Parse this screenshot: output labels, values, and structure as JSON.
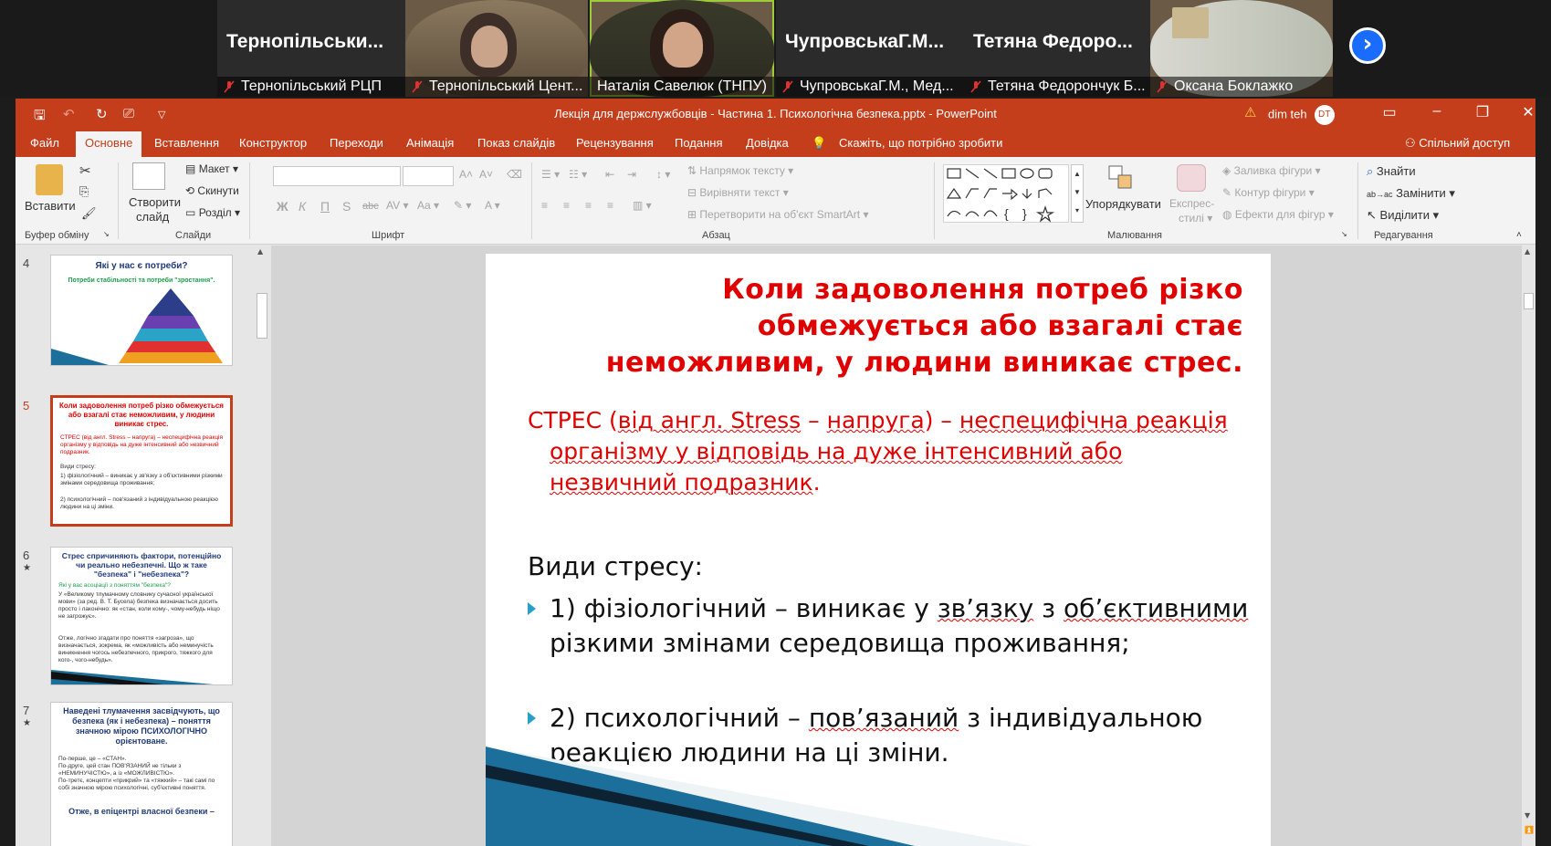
{
  "participants": [
    {
      "name_big": "Тернопільськи...",
      "caption": "Тернопільський РЦП",
      "video": false
    },
    {
      "name_big": "",
      "caption": "Тернопільський Цент...",
      "video": true
    },
    {
      "name_big": "",
      "caption": "Наталія Савелюк (ТНПУ)",
      "video": true
    },
    {
      "name_big": "ЧупровськаГ.М...",
      "caption": "ЧупровськаГ.М., Мед...",
      "video": false
    },
    {
      "name_big": "Тетяна Федоро...",
      "caption": "Тетяна Федорончук Б...",
      "video": false
    },
    {
      "name_big": "",
      "caption": "Оксана Боклажко",
      "video": true
    }
  ],
  "window": {
    "title": "Лекція для держслужбовців - Частина 1. Психологічна безпека.pptx  -  PowerPoint",
    "user_name": "dim teh",
    "user_initials": "DT"
  },
  "tabs": [
    "Файл",
    "Основне",
    "Вставлення",
    "Конструктор",
    "Переходи",
    "Анімація",
    "Показ слайдів",
    "Рецензування",
    "Подання",
    "Довідка"
  ],
  "tell_me": "Скажіть, що потрібно зробити",
  "share": "Спільний доступ",
  "ribbon": {
    "paste": "Вставити",
    "clipboard_group": "Буфер обміну",
    "new_slide_1": "Створити",
    "new_slide_2": "слайд",
    "layout": "Макет",
    "reset": "Скинути",
    "section": "Розділ",
    "slides_group": "Слайди",
    "font_group": "Шрифт",
    "text_direction": "Напрямок тексту",
    "align_text": "Вирівняти текст",
    "smartart": "Перетворити на об'єкт SmartArt",
    "paragraph_group": "Абзац",
    "arrange": "Упорядкувати",
    "quick_styles_1": "Експрес-",
    "quick_styles_2": "стилі",
    "shape_fill": "Заливка фігури",
    "shape_outline": "Контур фігури",
    "shape_effects": "Ефекти для фігур",
    "drawing_group": "Малювання",
    "find": "Знайти",
    "replace": "Замінити",
    "select": "Виділити",
    "editing_group": "Редагування"
  },
  "thumbnails": {
    "s4": {
      "num": "4",
      "title": "Які у нас є потреби?",
      "subtitle": "Потреби стабільності та потреби \"зростання\"."
    },
    "s5": {
      "num": "5",
      "title": "Коли задоволення потреб різко обмежується або взагалі стає неможливим, у людини виникає стрес.",
      "l1": "СТРЕС (від англ. Stress – напруга) – неспецифічна реакція організму у відповідь на дуже інтенсивний або незвичний подразник.",
      "l2": "Види стресу:",
      "l3": "1) фізіологічний – виникає у зв'язку з об'єктивними різкими змінами середовища проживання;",
      "l4": "2) психологічний – пов'язаний з індивідуальною реакцією людини на ці зміни."
    },
    "s6": {
      "num": "6",
      "title": "Стрес спричиняють фактори, потенційно чи реально небезпечні. Що ж таке \"безпека\" і \"небезпека\"?",
      "l1": "Які у вас асоціації з поняттям \"безпека\"?",
      "l2": "У «Великому тлумачному словнику сучасної української мови» (за ред. В. Т. Бусела) безпека визначається досить просто і лаконічно: як «стан, коли кому-, чому-небудь ніщо не загрожує».",
      "l3": "Отже, логічно згадати про поняття «загроза», що визначається, зокрема, як «можливість або неминучість виникнення чогось небезпечного, прикрого, тяжкого для кого-, чого-небудь»."
    },
    "s7": {
      "num": "7",
      "title": "Наведені тлумачення засвідчують, що безпека (як і небезпека) – поняття значною мірою ПСИХОЛОГІЧНО орієнтоване.",
      "l1": "По-перше, це – «СТАН».",
      "l2": "По-друге, цей стан ПОВ'ЯЗАНИЙ не тільки з «НЕМИНУЧІСТЮ», а із «МОЖЛИВІСТЮ».",
      "l3": "По-третє, концепти «прикрий» та «тяжкий» – такі самі по собі значною мірою психологічні, суб'єктивні поняття.",
      "l4": "Отже, в епіцентрі власної безпеки –"
    }
  },
  "slide": {
    "title": "Коли задоволення потреб різко обмежується або взагалі стає неможливим, у людини виникає стрес.",
    "def_a": "СТРЕС (",
    "def_b": "від англ. Stress",
    "def_c": " – ",
    "def_d": "напруга",
    "def_e": ") – ",
    "def_f": "неспецифічна реакція організму у відповідь на дуже інтенсивний або незвичний подразник",
    "def_g": ".",
    "types": "Види стресу:",
    "b1_a": "1) фізіологічний – виникає у ",
    "b1_b": "зв’язку",
    "b1_c": " з ",
    "b1_d": "об’єктивними",
    "b1_e": " різкими змінами середовища проживання;",
    "b2_a": "2) психологічний – ",
    "b2_b": "пов’язаний",
    "b2_c": " з індивідуальною реакцією людини на ці зміни."
  },
  "colors": {
    "accent": "#c43e1c",
    "slide_red": "#e00000",
    "bullet": "#2aa0c8"
  }
}
